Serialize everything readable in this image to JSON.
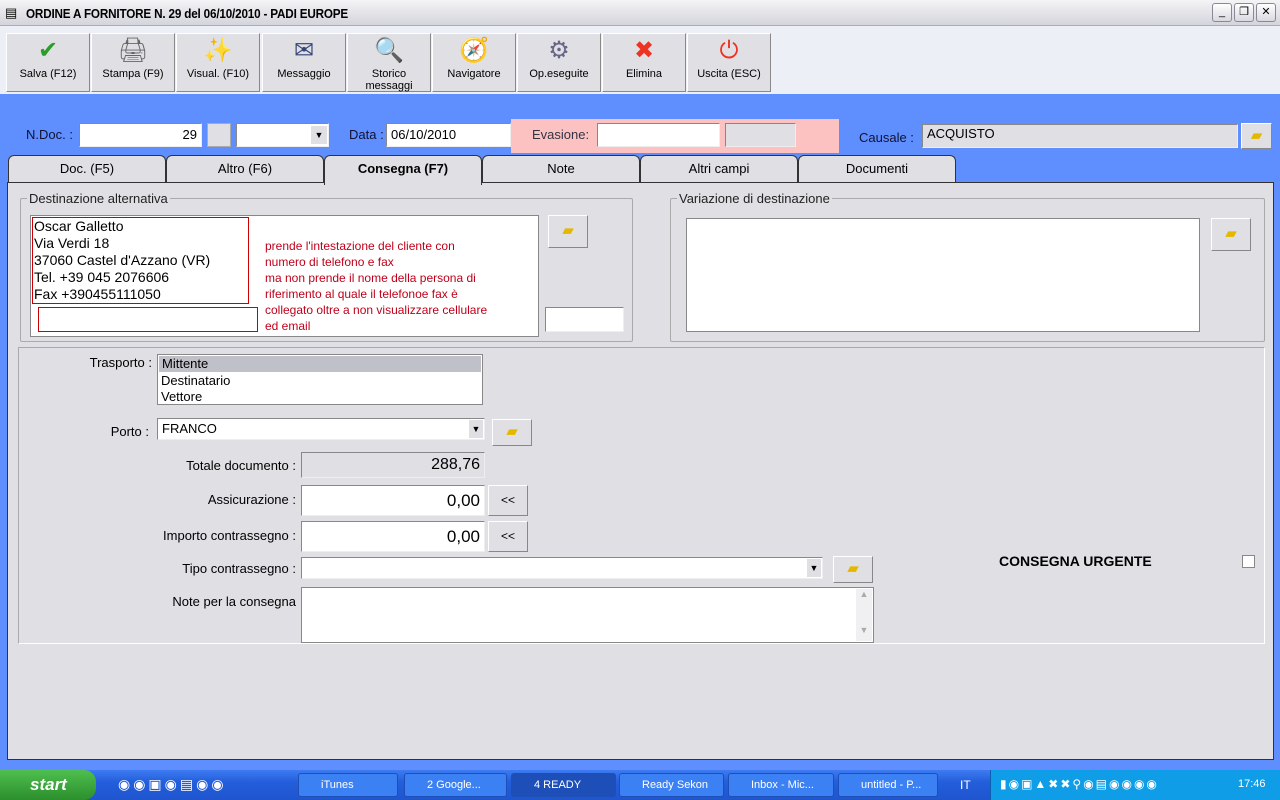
{
  "window": {
    "title": "ORDINE A FORNITORE N. 29  del 06/10/2010 - PADI EUROPE",
    "min": "_",
    "restore": "❐",
    "close": "✕"
  },
  "toolbar": [
    {
      "label": "Salva (F12)",
      "icon": "✔",
      "color": "#2a9d2a"
    },
    {
      "label": "Stampa (F9)",
      "icon": "🖨",
      "color": "#666"
    },
    {
      "label": "Visual. (F10)",
      "icon": "✨",
      "color": "#c90"
    },
    {
      "label": "Messaggio",
      "icon": "✉",
      "color": "#347"
    },
    {
      "label": "Storico messaggi",
      "icon": "🔍",
      "color": "#347"
    },
    {
      "label": "Navigatore",
      "icon": "🧭",
      "color": "#347"
    },
    {
      "label": "Op.eseguite",
      "icon": "⚙",
      "color": "#668"
    },
    {
      "label": "Elimina",
      "icon": "✖",
      "color": "#e32"
    },
    {
      "label": "Uscita (ESC)",
      "icon": "⏻",
      "color": "#e32"
    }
  ],
  "header": {
    "ndoc_label": "N.Doc. :",
    "ndoc_value": "29",
    "data_label": "Data :",
    "data_value": "06/10/2010",
    "evasione_label": "Evasione:",
    "causale_label": "Causale :",
    "causale_value": "ACQUISTO"
  },
  "tabs": [
    "Doc. (F5)",
    "Altro (F6)",
    "Consegna (F7)",
    "Note",
    "Altri campi",
    "Documenti"
  ],
  "dest": {
    "label": "Destinazione alternativa",
    "lines": [
      "Oscar Galletto",
      "Via Verdi 18",
      "37060 Castel d'Azzano (VR)",
      "Tel. +39 045 2076606",
      "Fax +390455111050"
    ],
    "note": [
      "prende l'intestazione del cliente con",
      "numero di telefono e fax",
      "ma non prende il nome della persona di",
      "riferimento al quale il telefonoe  fax è",
      "collegato oltre a non visualizzare cellulare",
      "ed email"
    ]
  },
  "variazione": {
    "label": "Variazione di destinazione"
  },
  "form": {
    "trasporto_label": "Trasporto :",
    "trasporto_options": [
      "Mittente",
      "Destinatario",
      "Vettore"
    ],
    "porto_label": "Porto :",
    "porto_value": "FRANCO",
    "totale_label": "Totale documento :",
    "totale_value": "288,76",
    "assic_label": "Assicurazione :",
    "assic_value": "0,00",
    "contr_label": "Importo contrassegno :",
    "contr_value": "0,00",
    "tipo_label": "Tipo contrassegno :",
    "note_label": "Note per la consegna",
    "urgent_label": "CONSEGNA URGENTE",
    "back": "<<"
  },
  "taskbar": {
    "start": "start",
    "tasks": [
      "iTunes",
      "2 Google...",
      "4 READY",
      "Ready Sekon",
      "Inbox - Mic...",
      "untitled - P..."
    ],
    "lang": "IT",
    "clock": "17:46"
  }
}
